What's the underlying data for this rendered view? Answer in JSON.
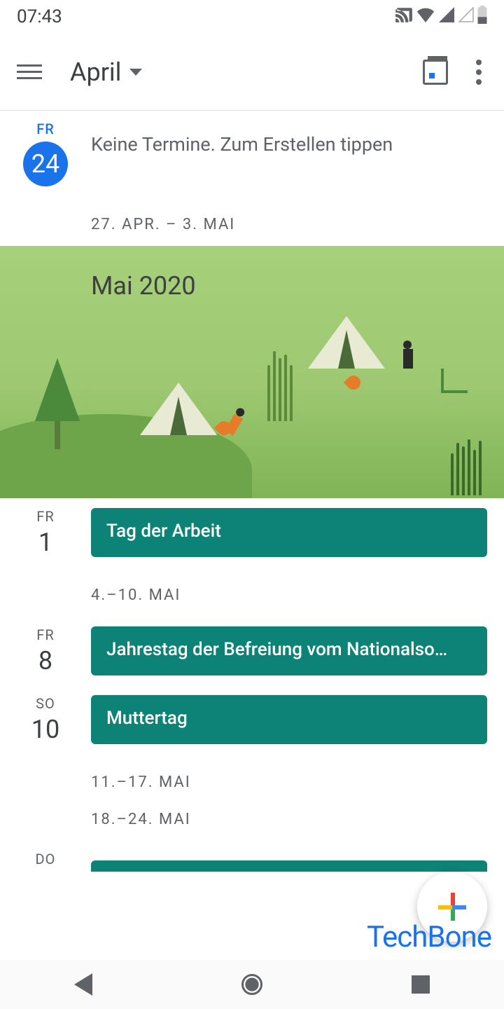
{
  "status": {
    "time": "07:43"
  },
  "appbar": {
    "month": "April"
  },
  "today": {
    "day_name": "FR",
    "day_num": "24",
    "empty_text": "Keine Termine. Zum Erstellen tippen"
  },
  "weeks": {
    "w1": "27. APR. – 3. MAI",
    "w2": "4.–10. MAI",
    "w3": "11.–17. MAI",
    "w4": "18.–24. MAI"
  },
  "month_banner": "Mai 2020",
  "events": {
    "e1": {
      "day_name": "FR",
      "day_num": "1",
      "title": "Tag der Arbeit"
    },
    "e2": {
      "day_name": "FR",
      "day_num": "8",
      "title": "Jahrestag der Befreiung vom Nationalso…"
    },
    "e3": {
      "day_name": "SO",
      "day_num": "10",
      "title": "Muttertag"
    },
    "e4": {
      "day_name": "DO"
    }
  },
  "watermark": "TechBone"
}
